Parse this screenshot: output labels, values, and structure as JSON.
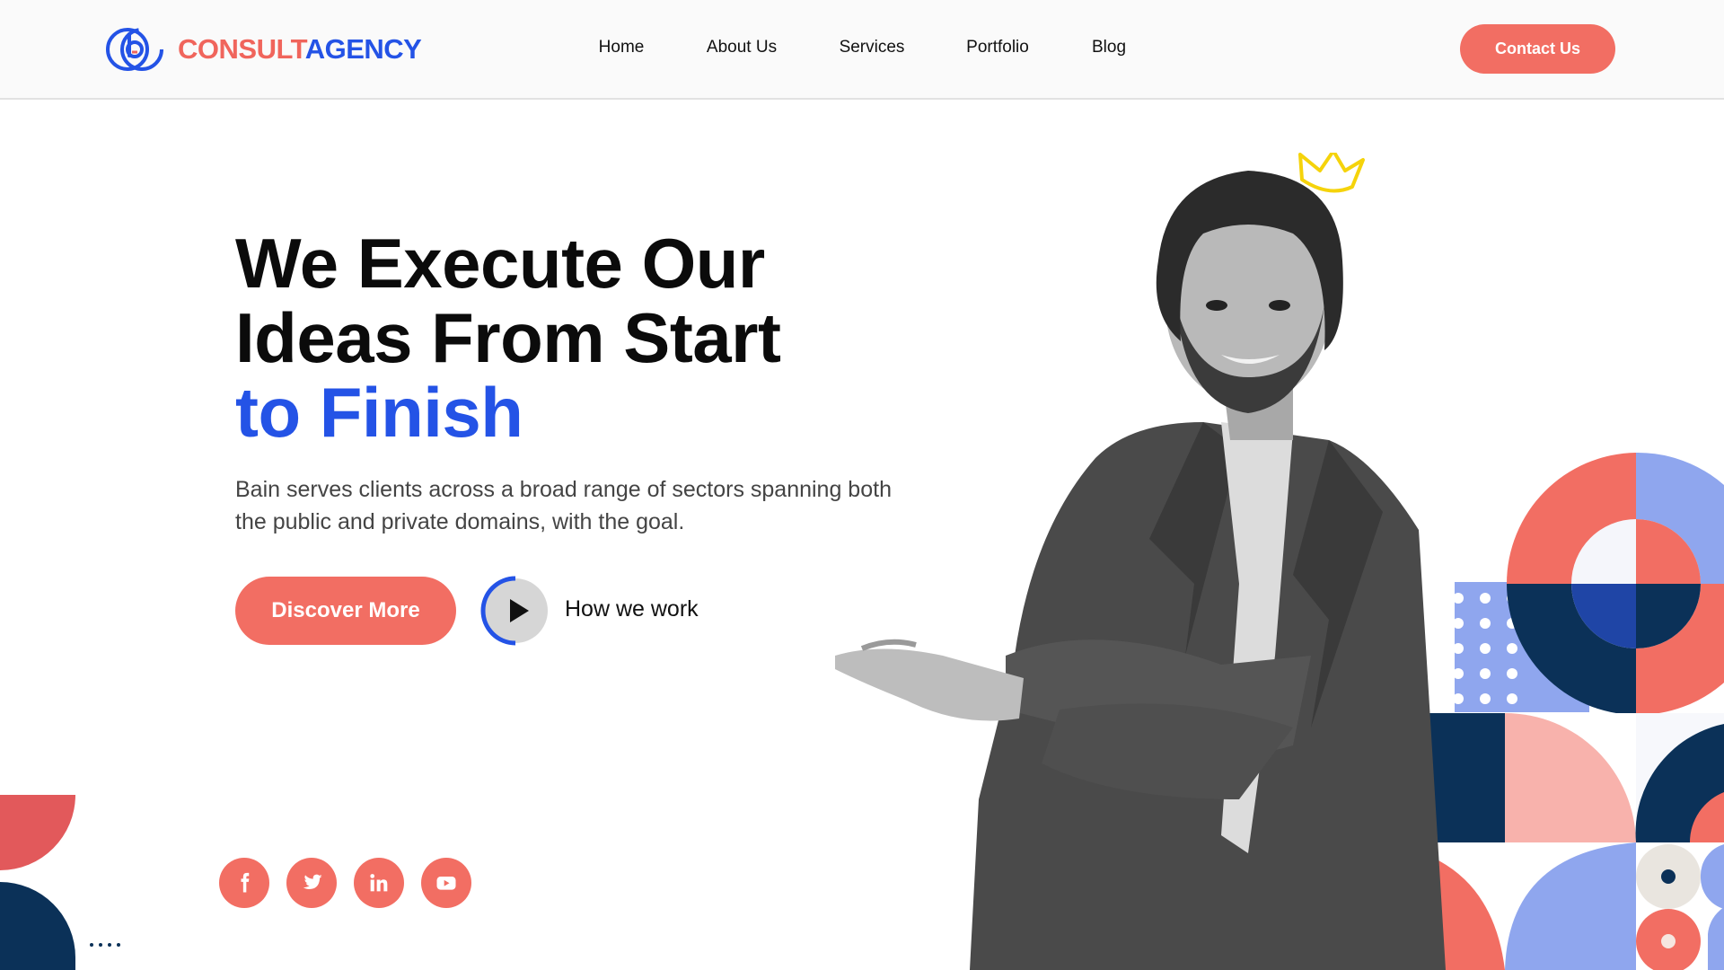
{
  "brand": {
    "name_part1": "CONSULT",
    "name_part2": "AGENCY",
    "logo_icon": "logo-mark-icon"
  },
  "nav": {
    "items": [
      {
        "label": "Home"
      },
      {
        "label": "About Us"
      },
      {
        "label": "Services"
      },
      {
        "label": "Portfolio"
      },
      {
        "label": "Blog"
      }
    ],
    "cta": "Contact Us"
  },
  "hero": {
    "title_line1": "We Execute Our",
    "title_line2": "Ideas From Start",
    "title_line3": "to Finish",
    "description": "Bain serves clients across a broad range of sectors spanning both the public and private domains, with the goal.",
    "primary_button": "Discover More",
    "video_link": "How we work"
  },
  "social": [
    {
      "icon": "facebook-icon"
    },
    {
      "icon": "twitter-icon"
    },
    {
      "icon": "linkedin-icon"
    },
    {
      "icon": "youtube-icon"
    }
  ],
  "colors": {
    "accent": "#f26e63",
    "brand_blue": "#2453e6",
    "navy": "#0b3158",
    "lavender": "#8fa6ee",
    "pink": "#f8b2ac"
  }
}
